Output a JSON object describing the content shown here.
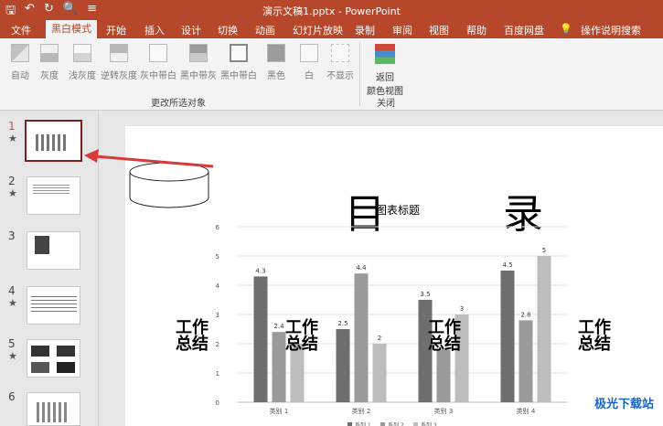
{
  "window": {
    "title": "演示文稿1.pptx - PowerPoint"
  },
  "tabs": [
    "文件",
    "黑白模式",
    "开始",
    "插入",
    "设计",
    "切换",
    "动画",
    "幻灯片放映",
    "录制",
    "审阅",
    "视图",
    "帮助",
    "百度网盘",
    "操作说明搜索"
  ],
  "ribbon": {
    "buttons": [
      "自动",
      "灰度",
      "浅灰度",
      "逆转灰度",
      "灰中带白",
      "黑中带灰",
      "黑中带白",
      "黑色",
      "白",
      "不显示"
    ],
    "group1": "更改所选对象",
    "return": "返回\n颜色视图",
    "group2": "关闭"
  },
  "thumbs": [
    {
      "num": "1",
      "star": "★"
    },
    {
      "num": "2",
      "star": "★"
    },
    {
      "num": "3",
      "star": ""
    },
    {
      "num": "4",
      "star": "★"
    },
    {
      "num": "5",
      "star": "★"
    },
    {
      "num": "6",
      "star": ""
    }
  ],
  "slide": {
    "title1": "目",
    "title2": "录",
    "wz": "工作\n总结",
    "chart_title": "图表标题"
  },
  "chart_data": {
    "type": "bar",
    "title": "图表标题",
    "categories": [
      "类别 1",
      "类别 2",
      "类别 3",
      "类别 4"
    ],
    "series": [
      {
        "values": [
          4.3,
          2.5,
          3.5,
          4.5
        ]
      },
      {
        "values": [
          2.4,
          4.4,
          1.8,
          2.8
        ]
      },
      {
        "values": [
          2,
          2,
          3,
          5
        ]
      }
    ],
    "data_labels": [
      [
        "4.3",
        "2.4",
        ""
      ],
      [
        "2.5",
        "4.4",
        "2"
      ],
      [
        "3.5",
        "",
        "3"
      ],
      [
        "4.5",
        "2.8",
        "5"
      ]
    ],
    "ylim": [
      0,
      6
    ],
    "yticks": [
      "0",
      "1",
      "2",
      "3",
      "4",
      "5",
      "6"
    ],
    "colors": [
      "#6e6e6e",
      "#9a9a9a",
      "#bdbdbd"
    ],
    "legend": [
      "系列 1",
      "系列 2",
      "系列 3"
    ]
  },
  "watermark": "极光下载站"
}
